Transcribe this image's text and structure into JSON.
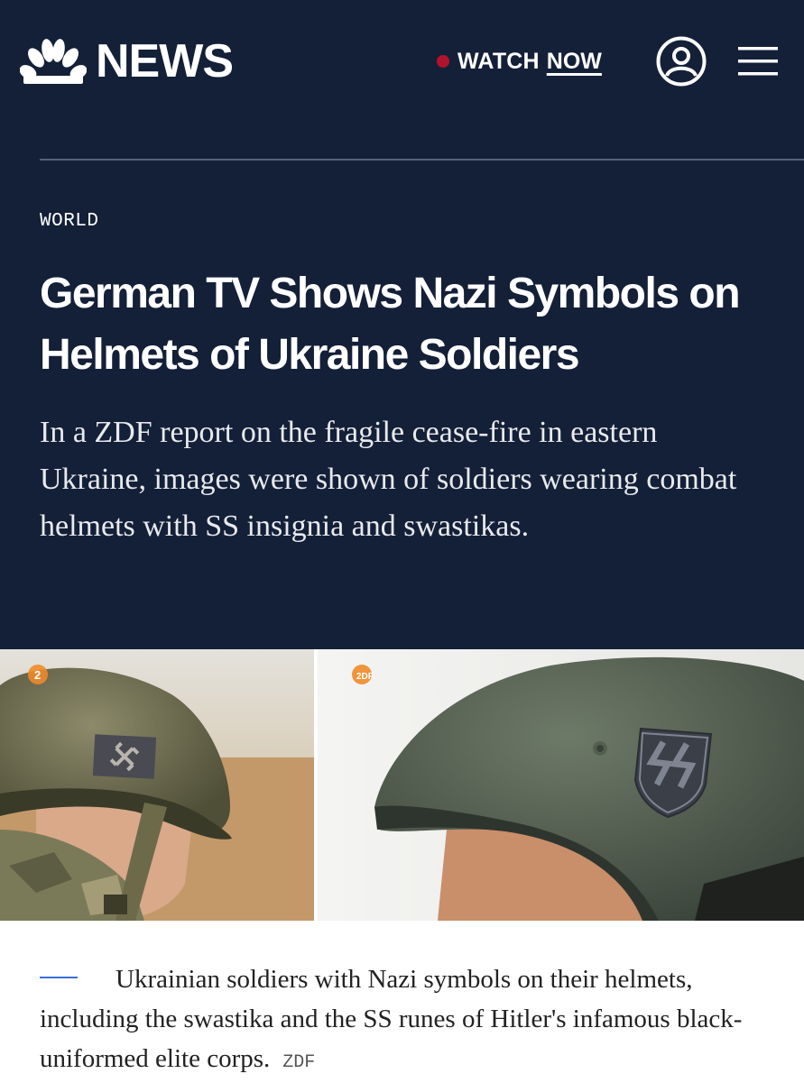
{
  "brand": {
    "logo_text": "NEWS",
    "logo_icon": "peacock-icon"
  },
  "nav": {
    "watch_label": "WATCH",
    "now_label": "NOW",
    "live_dot_color": "#b3122b",
    "account_icon": "user-icon",
    "menu_icon": "hamburger-menu-icon"
  },
  "article": {
    "section": "WORLD",
    "headline": "German TV Shows Nazi Symbols on Helmets of Ukraine Soldiers",
    "dek": "In a ZDF report on the fragile cease-fire in eastern Ukraine, images were shown of soldiers wearing combat helmets with SS insignia and swastikas."
  },
  "hero_image": {
    "left_watermark": "2",
    "right_watermark": "2DF"
  },
  "caption": {
    "text": "Ukrainian soldiers with Nazi symbols on their helmets, including the swastika and the SS runes of Hitler's infamous black-uniformed elite corps.",
    "credit": "ZDF"
  },
  "colors": {
    "header_bg": "#142038",
    "caption_rule": "#3a6fd8"
  }
}
